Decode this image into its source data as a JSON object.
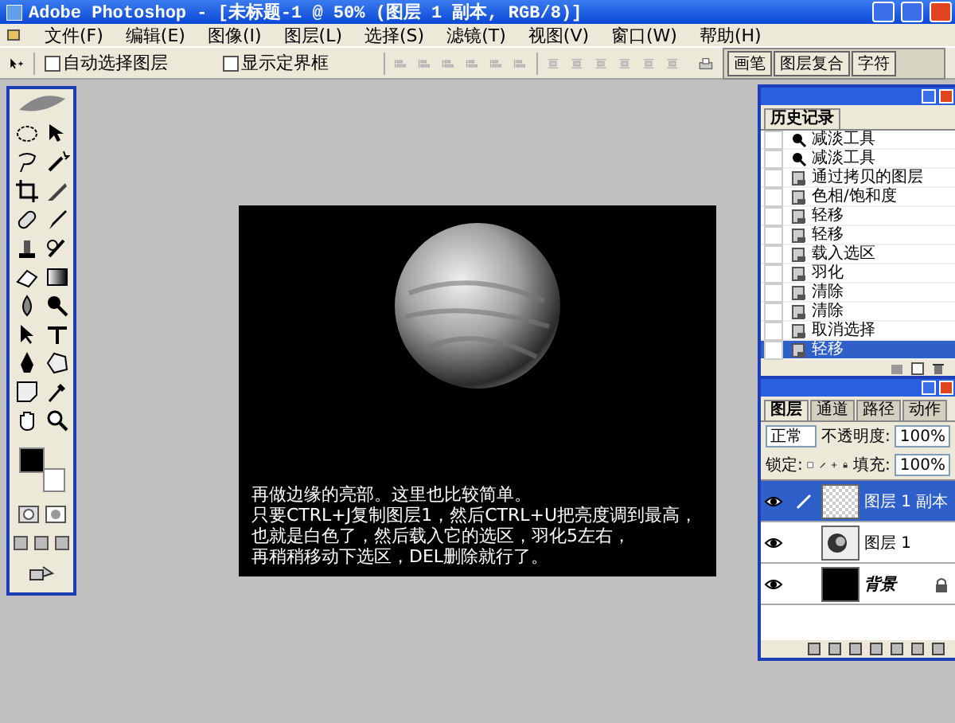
{
  "window": {
    "title": "Adobe Photoshop - [未标题-1 @ 50% (图层 1 副本, RGB/8)]"
  },
  "menu": [
    "文件(F)",
    "编辑(E)",
    "图像(I)",
    "图层(L)",
    "选择(S)",
    "滤镜(T)",
    "视图(V)",
    "窗口(W)",
    "帮助(H)"
  ],
  "options_bar": {
    "checkboxes": [
      {
        "label": "自动选择图层",
        "checked": false
      },
      {
        "label": "显示定界框",
        "checked": false
      }
    ]
  },
  "palette_well": {
    "tabs": [
      "画笔",
      "图层复合",
      "字符"
    ]
  },
  "canvas": {
    "caption_lines": [
      "再做边缘的亮部。这里也比较简单。",
      "只要CTRL+J复制图层1，然后CTRL+U把亮度调到最高，",
      "也就是白色了，然后载入它的选区，羽化5左右，",
      "再稍稍移动下选区，DEL删除就行了。"
    ]
  },
  "history": {
    "title": "历史记录",
    "items": [
      {
        "label": "减淡工具",
        "kind": "tool",
        "selected": false
      },
      {
        "label": "减淡工具",
        "kind": "tool",
        "selected": false
      },
      {
        "label": "通过拷贝的图层",
        "kind": "step",
        "selected": false
      },
      {
        "label": "色相/饱和度",
        "kind": "step",
        "selected": false
      },
      {
        "label": "轻移",
        "kind": "step",
        "selected": false
      },
      {
        "label": "轻移",
        "kind": "step",
        "selected": false
      },
      {
        "label": "载入选区",
        "kind": "step",
        "selected": false
      },
      {
        "label": "羽化",
        "kind": "step",
        "selected": false
      },
      {
        "label": "清除",
        "kind": "step",
        "selected": false
      },
      {
        "label": "清除",
        "kind": "step",
        "selected": false
      },
      {
        "label": "取消选择",
        "kind": "step",
        "selected": false
      },
      {
        "label": "轻移",
        "kind": "step",
        "selected": true
      }
    ]
  },
  "layers": {
    "tabs": [
      {
        "label": "图层",
        "selected": true
      },
      {
        "label": "通道",
        "selected": false
      },
      {
        "label": "路径",
        "selected": false
      },
      {
        "label": "动作",
        "selected": false
      }
    ],
    "blend_mode": "正常",
    "opacity_label": "不透明度:",
    "opacity": "100%",
    "lock_label": "锁定:",
    "fill_label": "填充:",
    "fill": "100%",
    "rows": [
      {
        "name": "图层 1 副本",
        "kind": "transparent",
        "visible": true,
        "selected": true,
        "locked": false,
        "italic": false
      },
      {
        "name": "图层 1",
        "kind": "planet",
        "visible": true,
        "selected": false,
        "locked": false,
        "italic": false
      },
      {
        "name": "背景",
        "kind": "black",
        "visible": true,
        "selected": false,
        "locked": true,
        "italic": true
      }
    ]
  }
}
